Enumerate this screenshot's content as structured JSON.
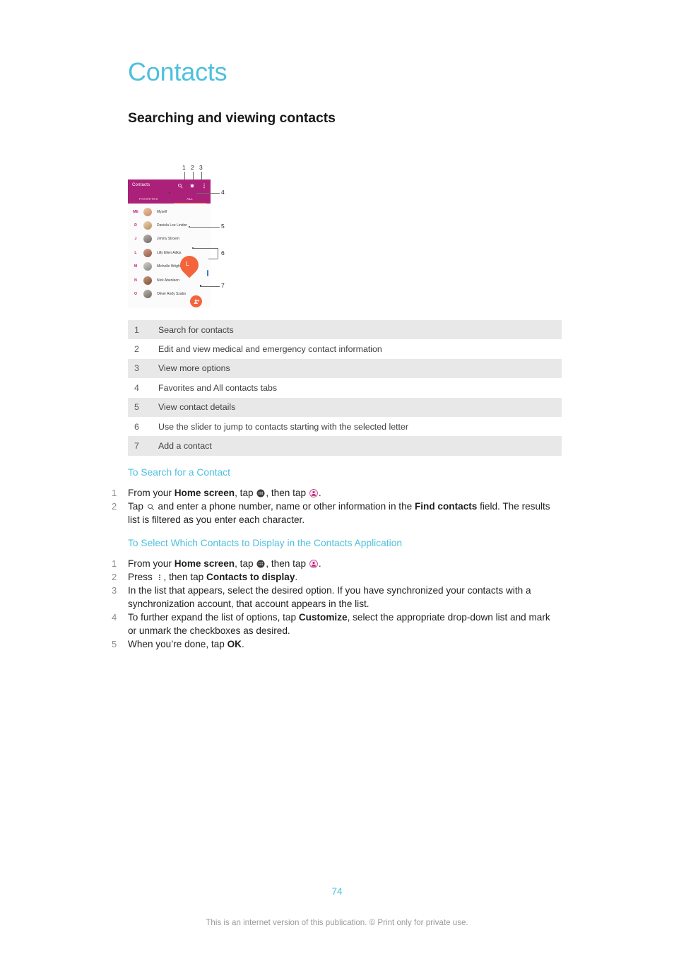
{
  "document": {
    "chapter_title": "Contacts",
    "section_title": "Searching and viewing contacts",
    "page_number": "74",
    "footer_note": "This is an internet version of this publication. © Print only for private use.",
    "accent_color": "#4ec0de",
    "header_color": "#ab2179",
    "fab_color": "#f4643c"
  },
  "illustration": {
    "app_title": "Contacts",
    "header_icons": [
      "search-icon",
      "medical-emergency-icon",
      "more-options-icon"
    ],
    "tabs": [
      {
        "label": "FAVORITES",
        "active": false
      },
      {
        "label": "ALL",
        "active": true
      }
    ],
    "contacts": [
      {
        "letter": "ME",
        "name": "Myself"
      },
      {
        "letter": "D",
        "name": "Daniela Lee Lindon"
      },
      {
        "letter": "J",
        "name": "Jimmy Stroem"
      },
      {
        "letter": "L",
        "name": "Lilly Ellen Adkis"
      },
      {
        "letter": "M",
        "name": "Michelle Wright"
      },
      {
        "letter": "N",
        "name": "Nick Abenleon"
      },
      {
        "letter": "O",
        "name": "Oliver Andy Szabo"
      }
    ],
    "slider_letter": "L",
    "callouts": [
      "1",
      "2",
      "3",
      "4",
      "5",
      "6",
      "7"
    ]
  },
  "legend": {
    "rows": [
      {
        "num": "1",
        "text": "Search for contacts"
      },
      {
        "num": "2",
        "text": "Edit and view medical and emergency contact information"
      },
      {
        "num": "3",
        "text": "View more options"
      },
      {
        "num": "4",
        "text": "Favorites and All contacts tabs"
      },
      {
        "num": "5",
        "text": "View contact details"
      },
      {
        "num": "6",
        "text": "Use the slider to jump to contacts starting with the selected letter"
      },
      {
        "num": "7",
        "text": "Add a contact"
      }
    ]
  },
  "procedure_search": {
    "title": "To Search for a Contact",
    "step1_num": "1",
    "step1_a": "From your ",
    "step1_b": "Home screen",
    "step1_c": ", tap ",
    "step1_d": ", then tap ",
    "step1_e": ".",
    "step2_num": "2",
    "step2_a": "Tap ",
    "step2_b": " and enter a phone number, name or other information in the ",
    "step2_c": "Find contacts",
    "step2_d": " field. The results list is filtered as you enter each character."
  },
  "procedure_display": {
    "title": "To Select Which Contacts to Display in the Contacts Application",
    "step1_num": "1",
    "step1_a": "From your ",
    "step1_b": "Home screen",
    "step1_c": ", tap ",
    "step1_d": ", then tap ",
    "step1_e": ".",
    "step2_num": "2",
    "step2_a": "Press ",
    "step2_b": ", then tap ",
    "step2_c": "Contacts to display",
    "step2_d": ".",
    "step3_num": "3",
    "step3_text": "In the list that appears, select the desired option. If you have synchronized your contacts with a synchronization account, that account appears in the list.",
    "step4_num": "4",
    "step4_a": "To further expand the list of options, tap ",
    "step4_b": "Customize",
    "step4_c": ", select the appropriate drop-down list and mark or unmark the checkboxes as desired.",
    "step5_num": "5",
    "step5_a": "When you’re done, tap ",
    "step5_b": "OK",
    "step5_c": "."
  }
}
